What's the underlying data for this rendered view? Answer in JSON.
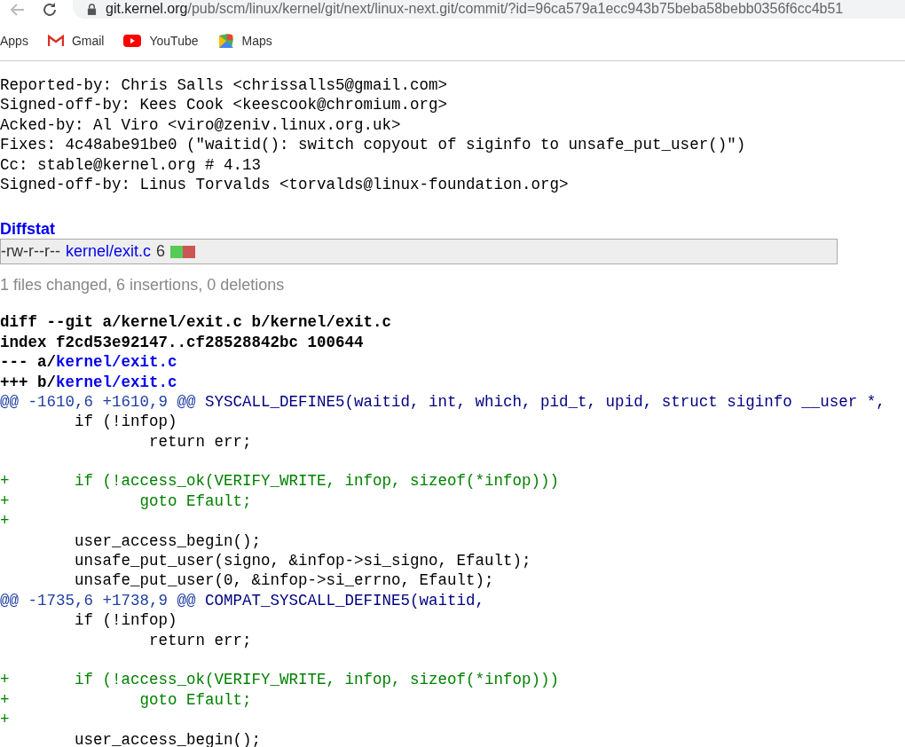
{
  "browser": {
    "url_host": "git.kernel.org",
    "url_path": "/pub/scm/linux/kernel/git/next/linux-next.git/commit/?id=96ca579a1ecc943b75beba58bebb0356f6cc4b51",
    "bookmarks": [
      {
        "label": "Apps"
      },
      {
        "label": "Gmail"
      },
      {
        "label": "YouTube"
      },
      {
        "label": "Maps"
      }
    ]
  },
  "commit_message": [
    "Reported-by: Chris Salls <chrissalls5@gmail.com>",
    "Signed-off-by: Kees Cook <keescook@chromium.org>",
    "Acked-by: Al Viro <viro@zeniv.linux.org.uk>",
    "Fixes: 4c48abe91be0 (\"waitid(): switch copyout of siginfo to unsafe_put_user()\")",
    "Cc: stable@kernel.org # 4.13",
    "Signed-off-by: Linus Torvalds <torvalds@linux-foundation.org>"
  ],
  "diffstat": {
    "title": "Diffstat",
    "rows": [
      {
        "mode": "-rw-r--r--",
        "file": "kernel/exit.c",
        "count": "6",
        "level": 0.5
      }
    ],
    "summary": "1 files changed, 6 insertions, 0 deletions"
  },
  "diff": [
    {
      "kind": "header",
      "text": "diff --git a/kernel/exit.c b/kernel/exit.c"
    },
    {
      "kind": "header",
      "text": "index f2cd53e92147..cf28528842bc 100644"
    },
    {
      "kind": "file",
      "prefix": "--- a/",
      "path": "kernel/exit.c"
    },
    {
      "kind": "file",
      "prefix": "+++ b/",
      "path": "kernel/exit.c"
    },
    {
      "kind": "hunk",
      "range": "@@ -1610,6 +1610,9 @@",
      "text": "SYSCALL_DEFINE5(waitid, int, which, pid_t, upid, struct siginfo __user *,"
    },
    {
      "kind": "context",
      "text": " \tif (!infop)"
    },
    {
      "kind": "context",
      "text": " \t\treturn err;"
    },
    {
      "kind": "blank"
    },
    {
      "kind": "add",
      "text": "+\tif (!access_ok(VERIFY_WRITE, infop, sizeof(*infop)))"
    },
    {
      "kind": "add",
      "text": "+\t\tgoto Efault;"
    },
    {
      "kind": "add",
      "text": "+"
    },
    {
      "kind": "context",
      "text": " \tuser_access_begin();"
    },
    {
      "kind": "context",
      "text": " \tunsafe_put_user(signo, &infop->si_signo, Efault);"
    },
    {
      "kind": "context",
      "text": " \tunsafe_put_user(0, &infop->si_errno, Efault);"
    },
    {
      "kind": "hunk",
      "range": "@@ -1735,6 +1738,9 @@",
      "text": "COMPAT_SYSCALL_DEFINE5(waitid,"
    },
    {
      "kind": "context",
      "text": " \tif (!infop)"
    },
    {
      "kind": "context",
      "text": " \t\treturn err;"
    },
    {
      "kind": "blank"
    },
    {
      "kind": "add",
      "text": "+\tif (!access_ok(VERIFY_WRITE, infop, sizeof(*infop)))"
    },
    {
      "kind": "add",
      "text": "+\t\tgoto Efault;"
    },
    {
      "kind": "add",
      "text": "+"
    },
    {
      "kind": "context",
      "text": " \tuser_access_begin();"
    }
  ]
}
